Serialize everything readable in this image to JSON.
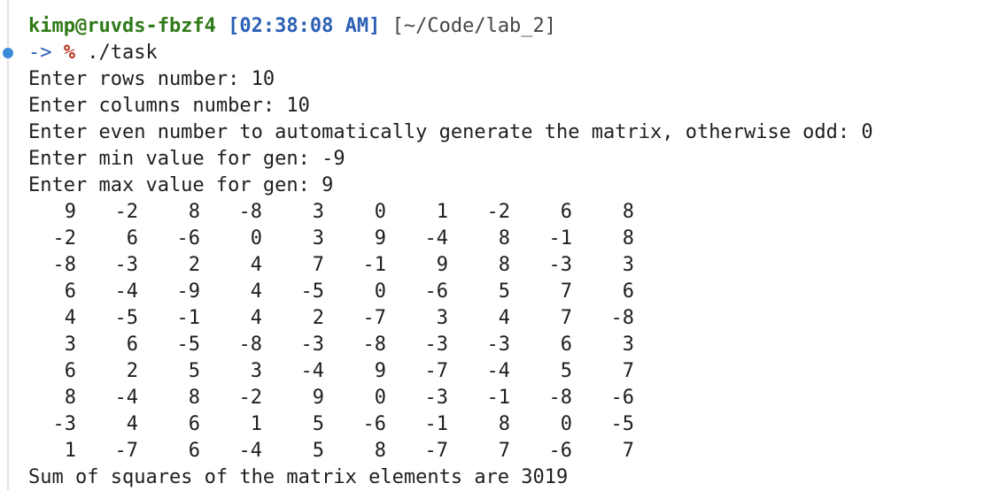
{
  "prompt": {
    "user_host": "kimp@ruvds-fbzf4",
    "time": "[02:38:08 AM]",
    "path": "[~/Code/lab_2]",
    "arrow": "->",
    "symbol": "%",
    "command": "./task"
  },
  "output_lines": [
    "Enter rows number: 10",
    "Enter columns number: 10",
    "Enter even number to automatically generate the matrix, otherwise odd: 0",
    "Enter min value for gen: -9",
    "Enter max value for gen: 9"
  ],
  "matrix": [
    [
      "9",
      "-2",
      "8",
      "-8",
      "3",
      "0",
      "1",
      "-2",
      "6",
      "8"
    ],
    [
      "-2",
      "6",
      "-6",
      "0",
      "3",
      "9",
      "-4",
      "8",
      "-1",
      "8"
    ],
    [
      "-8",
      "-3",
      "2",
      "4",
      "7",
      "-1",
      "9",
      "8",
      "-3",
      "3"
    ],
    [
      "6",
      "-4",
      "-9",
      "4",
      "-5",
      "0",
      "-6",
      "5",
      "7",
      "6"
    ],
    [
      "4",
      "-5",
      "-1",
      "4",
      "2",
      "-7",
      "3",
      "4",
      "7",
      "-8"
    ],
    [
      "3",
      "6",
      "-5",
      "-8",
      "-3",
      "-8",
      "-3",
      "-3",
      "6",
      "3"
    ],
    [
      "6",
      "2",
      "5",
      "3",
      "-4",
      "9",
      "-7",
      "-4",
      "5",
      "7"
    ],
    [
      "8",
      "-4",
      "8",
      "-2",
      "9",
      "0",
      "-3",
      "-1",
      "-8",
      "-6"
    ],
    [
      "-3",
      "4",
      "6",
      "1",
      "5",
      "-6",
      "-1",
      "8",
      "0",
      "-5"
    ],
    [
      "1",
      "-7",
      "6",
      "-4",
      "5",
      "8",
      "-7",
      "7",
      "-6",
      "7"
    ]
  ],
  "summary": "Sum of squares of the matrix elements are 3019",
  "colors": {
    "user_host": "#2f7a18",
    "time": "#2b5fb5",
    "prompt_dot": "#3b8ad9"
  }
}
